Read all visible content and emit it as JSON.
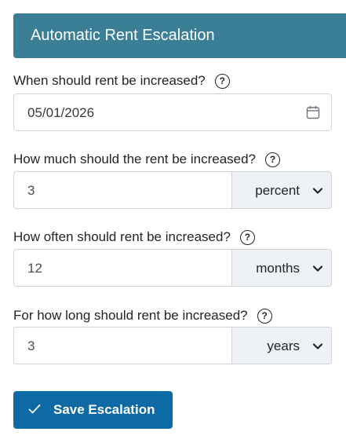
{
  "header": {
    "title": "Automatic Rent Escalation"
  },
  "fields": {
    "start_date": {
      "label": "When should rent be increased?",
      "value": "05/01/2026",
      "help_icon": "question-circle-icon",
      "calendar_icon": "calendar-icon"
    },
    "amount": {
      "label": "How much should the rent be increased?",
      "value": "3",
      "unit": "percent",
      "help_icon": "question-circle-icon"
    },
    "frequency": {
      "label": "How often should rent be increased?",
      "value": "12",
      "unit": "months",
      "help_icon": "question-circle-icon"
    },
    "duration": {
      "label": "For how long should rent be increased?",
      "value": "3",
      "unit": "years",
      "help_icon": "question-circle-icon"
    }
  },
  "help_glyph": "?",
  "actions": {
    "save_label": "Save Escalation",
    "save_icon": "check-icon"
  },
  "colors": {
    "header_bg": "#3a7f96",
    "button_bg": "#0e6aa5",
    "select_bg": "#eef1f5"
  }
}
